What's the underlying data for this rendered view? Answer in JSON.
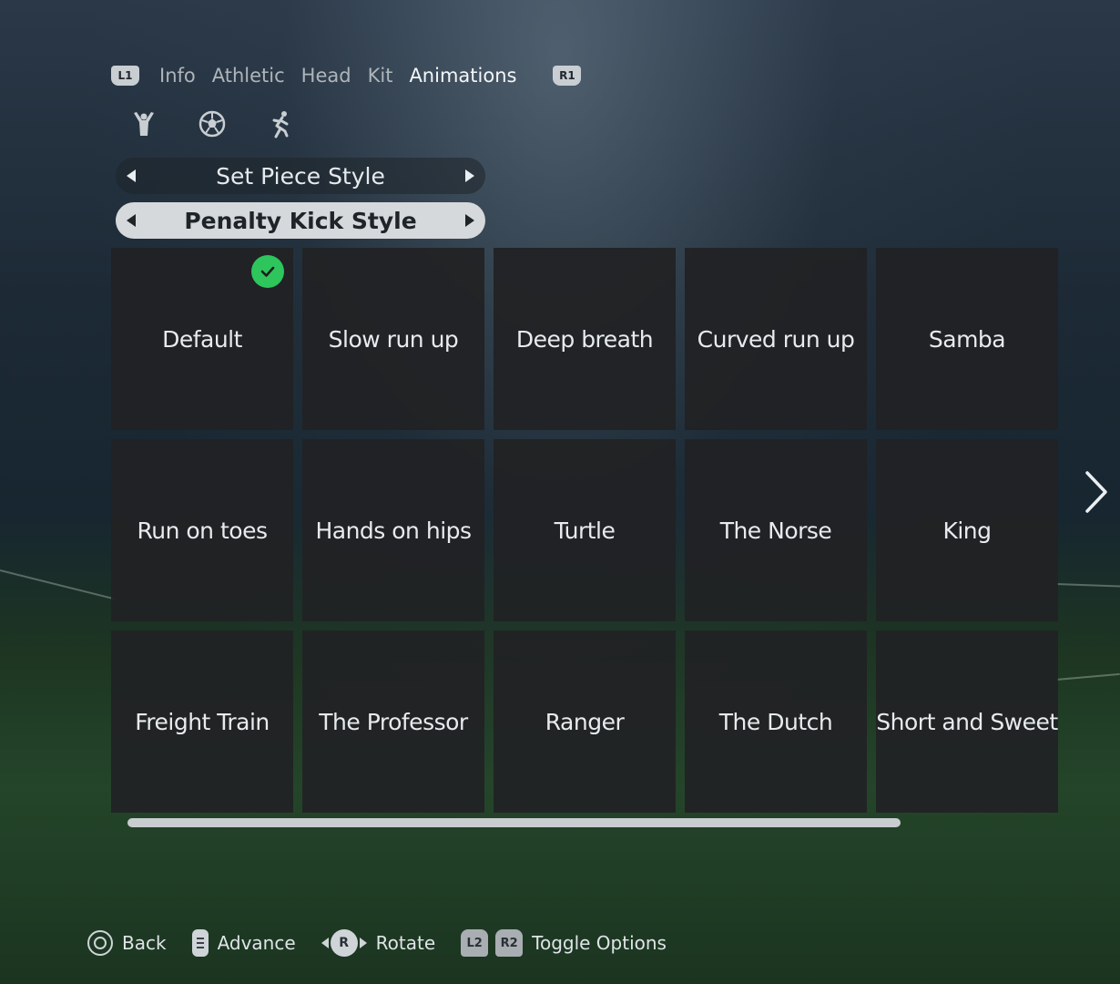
{
  "tabs": {
    "left_bumper": "L1",
    "right_bumper": "R1",
    "items": [
      {
        "label": "Info"
      },
      {
        "label": "Athletic"
      },
      {
        "label": "Head"
      },
      {
        "label": "Kit"
      },
      {
        "label": "Animations",
        "active": true
      }
    ]
  },
  "sub_icons": [
    "celebration-icon",
    "football-icon",
    "running-player-icon"
  ],
  "selectors": {
    "set_piece": "Set Piece Style",
    "penalty": "Penalty Kick Style"
  },
  "grid": {
    "selected": "Default",
    "items": [
      "Default",
      "Slow run up",
      "Deep breath",
      "Curved run up",
      "Samba",
      "Run on toes",
      "Hands on hips",
      "Turtle",
      "The Norse",
      "King",
      "Freight Train",
      "The Professor",
      "Ranger",
      "The Dutch",
      "Short and Sweet"
    ]
  },
  "footer": {
    "back": "Back",
    "advance": "Advance",
    "r_button": "R",
    "rotate": "Rotate",
    "l2": "L2",
    "r2": "R2",
    "toggle": "Toggle Options"
  },
  "colors": {
    "selected_check": "#2ec55d",
    "cell_bg": "#212224",
    "active_selector_bg": "#d6d9dc"
  }
}
